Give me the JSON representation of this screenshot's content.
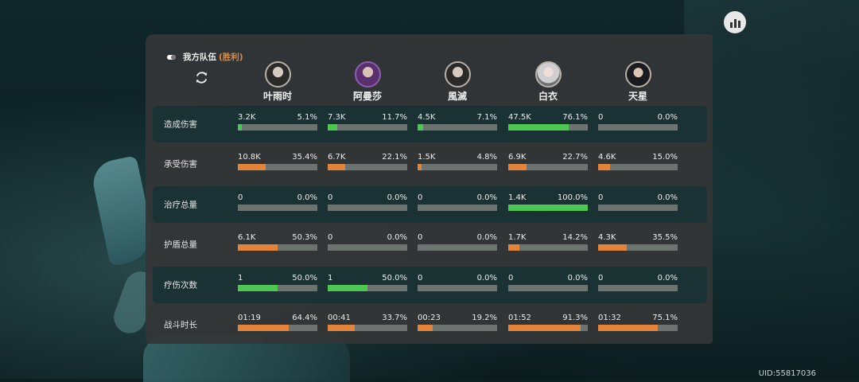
{
  "uid": "UID:55817036",
  "team": {
    "title": "我方队伍",
    "result": "(胜利)"
  },
  "colors": {
    "green": "#4cc74f",
    "orange": "#e4833a",
    "track": "#6c7370"
  },
  "heroes": [
    {
      "name": "叶雨时",
      "avatar": "avatar-yeyushi"
    },
    {
      "name": "阿曼莎",
      "avatar": "avatar-amansha"
    },
    {
      "name": "風滅",
      "avatar": "avatar-fengmie"
    },
    {
      "name": "白衣",
      "avatar": "avatar-baiyi"
    },
    {
      "name": "天星",
      "avatar": "avatar-tianxing"
    }
  ],
  "stats": [
    {
      "label": "造成伤害",
      "color": "green",
      "highlight": true,
      "cells": [
        {
          "value": "3.2K",
          "percent": "5.1%",
          "fraction": 0.051
        },
        {
          "value": "7.3K",
          "percent": "11.7%",
          "fraction": 0.117
        },
        {
          "value": "4.5K",
          "percent": "7.1%",
          "fraction": 0.071
        },
        {
          "value": "47.5K",
          "percent": "76.1%",
          "fraction": 0.761
        },
        {
          "value": "0",
          "percent": "0.0%",
          "fraction": 0
        }
      ]
    },
    {
      "label": "承受伤害",
      "color": "orange",
      "highlight": false,
      "cells": [
        {
          "value": "10.8K",
          "percent": "35.4%",
          "fraction": 0.354
        },
        {
          "value": "6.7K",
          "percent": "22.1%",
          "fraction": 0.221
        },
        {
          "value": "1.5K",
          "percent": "4.8%",
          "fraction": 0.048
        },
        {
          "value": "6.9K",
          "percent": "22.7%",
          "fraction": 0.227
        },
        {
          "value": "4.6K",
          "percent": "15.0%",
          "fraction": 0.15
        }
      ]
    },
    {
      "label": "治疗总量",
      "color": "green",
      "highlight": true,
      "cells": [
        {
          "value": "0",
          "percent": "0.0%",
          "fraction": 0
        },
        {
          "value": "0",
          "percent": "0.0%",
          "fraction": 0
        },
        {
          "value": "0",
          "percent": "0.0%",
          "fraction": 0
        },
        {
          "value": "1.4K",
          "percent": "100.0%",
          "fraction": 1.0
        },
        {
          "value": "0",
          "percent": "0.0%",
          "fraction": 0
        }
      ]
    },
    {
      "label": "护盾总量",
      "color": "orange",
      "highlight": false,
      "cells": [
        {
          "value": "6.1K",
          "percent": "50.3%",
          "fraction": 0.503
        },
        {
          "value": "0",
          "percent": "0.0%",
          "fraction": 0
        },
        {
          "value": "0",
          "percent": "0.0%",
          "fraction": 0
        },
        {
          "value": "1.7K",
          "percent": "14.2%",
          "fraction": 0.142
        },
        {
          "value": "4.3K",
          "percent": "35.5%",
          "fraction": 0.355
        }
      ]
    },
    {
      "label": "疗伤次数",
      "color": "green",
      "highlight": true,
      "cells": [
        {
          "value": "1",
          "percent": "50.0%",
          "fraction": 0.5
        },
        {
          "value": "1",
          "percent": "50.0%",
          "fraction": 0.5
        },
        {
          "value": "0",
          "percent": "0.0%",
          "fraction": 0
        },
        {
          "value": "0",
          "percent": "0.0%",
          "fraction": 0
        },
        {
          "value": "0",
          "percent": "0.0%",
          "fraction": 0
        }
      ]
    },
    {
      "label": "战斗时长",
      "color": "orange",
      "highlight": false,
      "cells": [
        {
          "value": "01:19",
          "percent": "64.4%",
          "fraction": 0.644
        },
        {
          "value": "00:41",
          "percent": "33.7%",
          "fraction": 0.337
        },
        {
          "value": "00:23",
          "percent": "19.2%",
          "fraction": 0.192
        },
        {
          "value": "01:52",
          "percent": "91.3%",
          "fraction": 0.913
        },
        {
          "value": "01:32",
          "percent": "75.1%",
          "fraction": 0.751
        }
      ]
    }
  ]
}
